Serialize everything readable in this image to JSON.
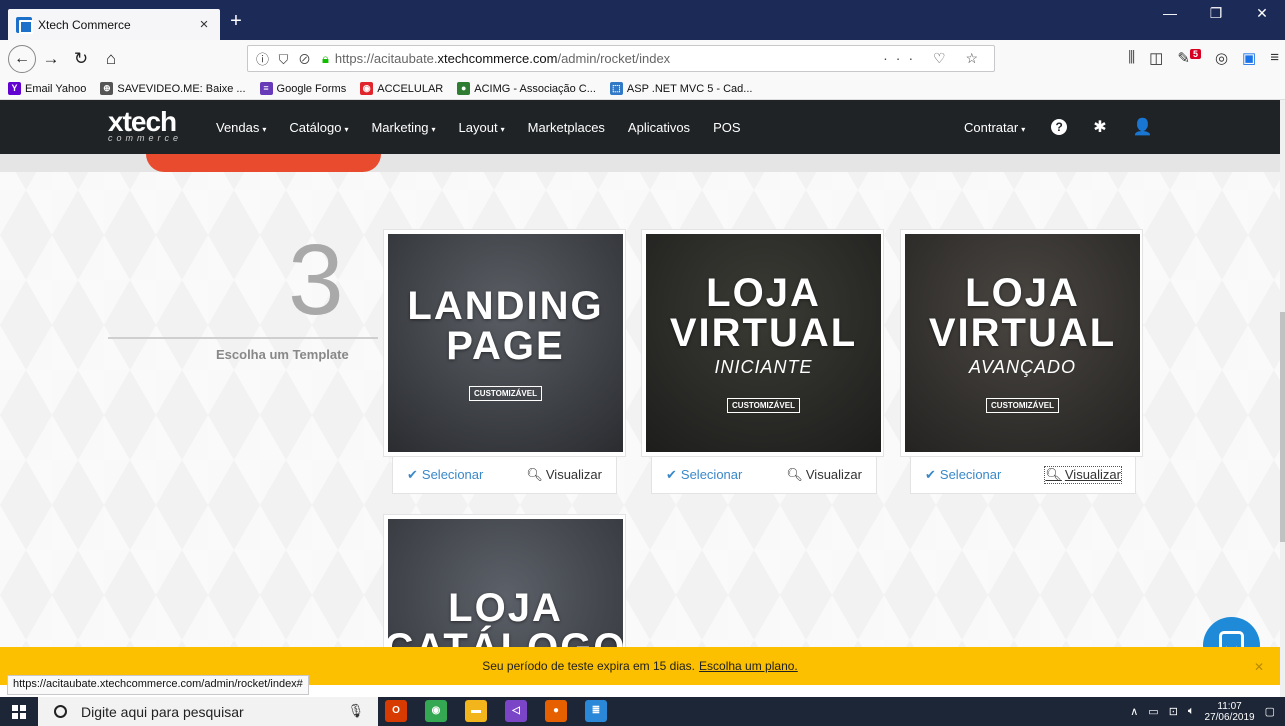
{
  "browser": {
    "tab_title": "Xtech Commerce",
    "tab_close": "×",
    "new_tab": "+",
    "url_prefix": "https://acitaubate.",
    "url_domain": "xtechcommerce.com",
    "url_path": "/admin/rocket/index",
    "url_icons": "ⓘ ⛉ ⊘",
    "url_right_icons": "··· ♡ ☆",
    "back": "←",
    "forward": "→",
    "reload": "↻",
    "home": "⌂",
    "notification_count": "5",
    "status_url": "https://acitaubate.xtechcommerce.com/admin/rocket/index#",
    "window_controls": [
      "—",
      "❐",
      "✕"
    ]
  },
  "bookmarks": [
    {
      "label": "Email Yahoo",
      "color": "#6001d2",
      "glyph": "Y"
    },
    {
      "label": "SAVEVIDEO.ME: Baixe ...",
      "color": "#555555",
      "glyph": "⊕"
    },
    {
      "label": "Google Forms",
      "color": "#673ab7",
      "glyph": "≡"
    },
    {
      "label": "ACCELULAR",
      "color": "#e0262c",
      "glyph": "◉"
    },
    {
      "label": "ACIMG - Associação C...",
      "color": "#2e7d32",
      "glyph": "●"
    },
    {
      "label": "ASP .NET MVC 5 - Cad...",
      "color": "#3178c6",
      "glyph": "⬚"
    }
  ],
  "app": {
    "logo_main": "xtech",
    "logo_sub": "commerce",
    "menu": [
      {
        "label": "Vendas",
        "caret": true
      },
      {
        "label": "Catálogo",
        "caret": true
      },
      {
        "label": "Marketing",
        "caret": true
      },
      {
        "label": "Layout",
        "caret": true
      },
      {
        "label": "Marketplaces",
        "caret": false
      },
      {
        "label": "Aplicativos",
        "caret": false
      },
      {
        "label": "POS",
        "caret": false
      }
    ],
    "contratar": "Contratar",
    "caret": "▾",
    "help_glyph": "?",
    "gear_glyph": "✱",
    "user_glyph": "👤"
  },
  "step": {
    "number": "3",
    "label": "Escolha um Template"
  },
  "templates": [
    {
      "title_1": "LANDING",
      "title_2": "PAGE",
      "subtitle": "",
      "tag": "CUSTOMIZÁVEL",
      "select": "Selecionar",
      "preview": "Visualizar",
      "bg_a": "#5a5e64",
      "bg_b": "#2a2c30"
    },
    {
      "title_1": "LOJA",
      "title_2": "VIRTUAL",
      "subtitle": "INICIANTE",
      "tag": "CUSTOMIZÁVEL",
      "select": "Selecionar",
      "preview": "Visualizar",
      "bg_a": "#3b3b35",
      "bg_b": "#1d1e1c"
    },
    {
      "title_1": "LOJA",
      "title_2": "VIRTUAL",
      "subtitle": "AVANÇADO",
      "tag": "CUSTOMIZÁVEL",
      "select": "Selecionar",
      "preview": "Visualizar",
      "bg_a": "#4a4642",
      "bg_b": "#242321"
    },
    {
      "title_1": "LOJA",
      "title_2": "CATÁLOGO",
      "subtitle": "",
      "tag": "",
      "select": "",
      "preview": "",
      "bg_a": "#5c6068",
      "bg_b": "#2e3136"
    }
  ],
  "check_glyph": "✔",
  "search_glyph": "🔍︎",
  "trial": {
    "message": "Seu período de teste expira em 15 dias.",
    "link": "Escolha um plano.",
    "close": "✕"
  },
  "taskbar": {
    "search_placeholder": "Digite aqui para pesquisar",
    "time": "11:07",
    "date": "27/06/2019",
    "apps": [
      {
        "name": "outlook",
        "color": "#d83b01",
        "glyph": "O"
      },
      {
        "name": "chrome",
        "color": "#34a853",
        "glyph": "◉"
      },
      {
        "name": "explorer",
        "color": "#f2b51c",
        "glyph": "▬"
      },
      {
        "name": "visual-studio",
        "color": "#7a46c7",
        "glyph": "◁"
      },
      {
        "name": "firefox",
        "color": "#e66000",
        "glyph": "●"
      },
      {
        "name": "notepad",
        "color": "#2b88d8",
        "glyph": "≣"
      }
    ]
  }
}
